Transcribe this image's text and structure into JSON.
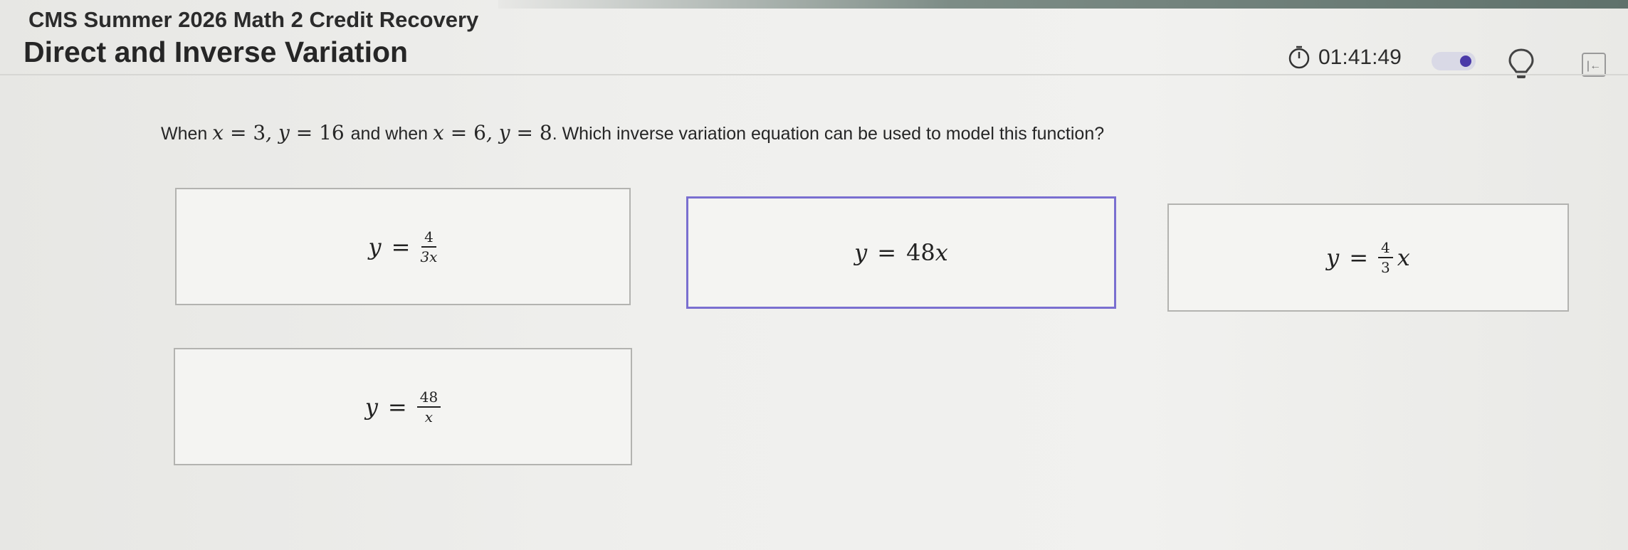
{
  "header": {
    "course_title": "CMS Summer 2026 Math 2 Credit Recovery",
    "lesson_title": "Direct and Inverse Variation",
    "timer": "01:41:49",
    "icons": {
      "timer": "stopwatch-icon",
      "hint": "lightbulb-icon",
      "collapse": "collapse-panel-icon"
    }
  },
  "question": {
    "text_when": "When",
    "x1_var": "x",
    "x1_eq": "=",
    "x1_val": "3",
    "y1_var": "y",
    "y1_eq": "=",
    "y1_val": "16",
    "text_and": "and when",
    "x2_var": "x",
    "x2_eq": "=",
    "x2_val": "6",
    "y2_var": "y",
    "y2_eq": "=",
    "y2_val": "8",
    "text_tail": ". Which inverse variation equation can be used to model this function?"
  },
  "choices": [
    {
      "lhs": "y",
      "eq": "=",
      "num": "4",
      "den": "3x"
    },
    {
      "lhs": "y",
      "eq": "=",
      "coef": "48",
      "var": "x",
      "selected": true
    },
    {
      "lhs": "y",
      "eq": "=",
      "num": "4",
      "den": "3",
      "var": "x"
    },
    {
      "lhs": "y",
      "eq": "=",
      "num": "48",
      "den": "x"
    }
  ],
  "colors": {
    "selected_border": "#7a6fd0",
    "toggle_knob": "#4a3aa8"
  }
}
